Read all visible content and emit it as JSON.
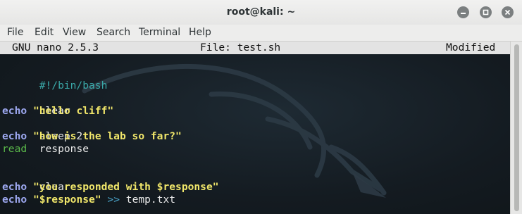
{
  "window": {
    "title": "root@kali: ~"
  },
  "menu": [
    "File",
    "Edit",
    "View",
    "Search",
    "Terminal",
    "Help"
  ],
  "nano": {
    "version": "GNU nano 2.5.3",
    "file": "File: test.sh",
    "status": "Modified"
  },
  "editor": {
    "line1": "#!/bin/bash",
    "line3": "clear",
    "line4_cmd": "echo",
    "line4_str": "\"hello cliff\"",
    "line5": "sleep 2",
    "line6_cmd": "echo",
    "line6_str": "\"how is the lab so far?\"",
    "line7_cmd": "read",
    "line7_arg": "response",
    "line9": "clear",
    "line10_cmd": "echo",
    "line10_str": "\"you responded with $response\"",
    "line11_cmd": "echo",
    "line11_str": "\"$response\"",
    "line11_op": ">>",
    "line11_file": "temp.txt"
  },
  "icons": {
    "minimize": "minimize-icon",
    "maximize": "maximize-icon",
    "close": "close-icon"
  },
  "colors": {
    "keyword": "#9da8f0",
    "string": "#f0e66a",
    "comment": "#3aa8a8",
    "read": "#5ab84a",
    "redirect": "#4aa3c8"
  }
}
